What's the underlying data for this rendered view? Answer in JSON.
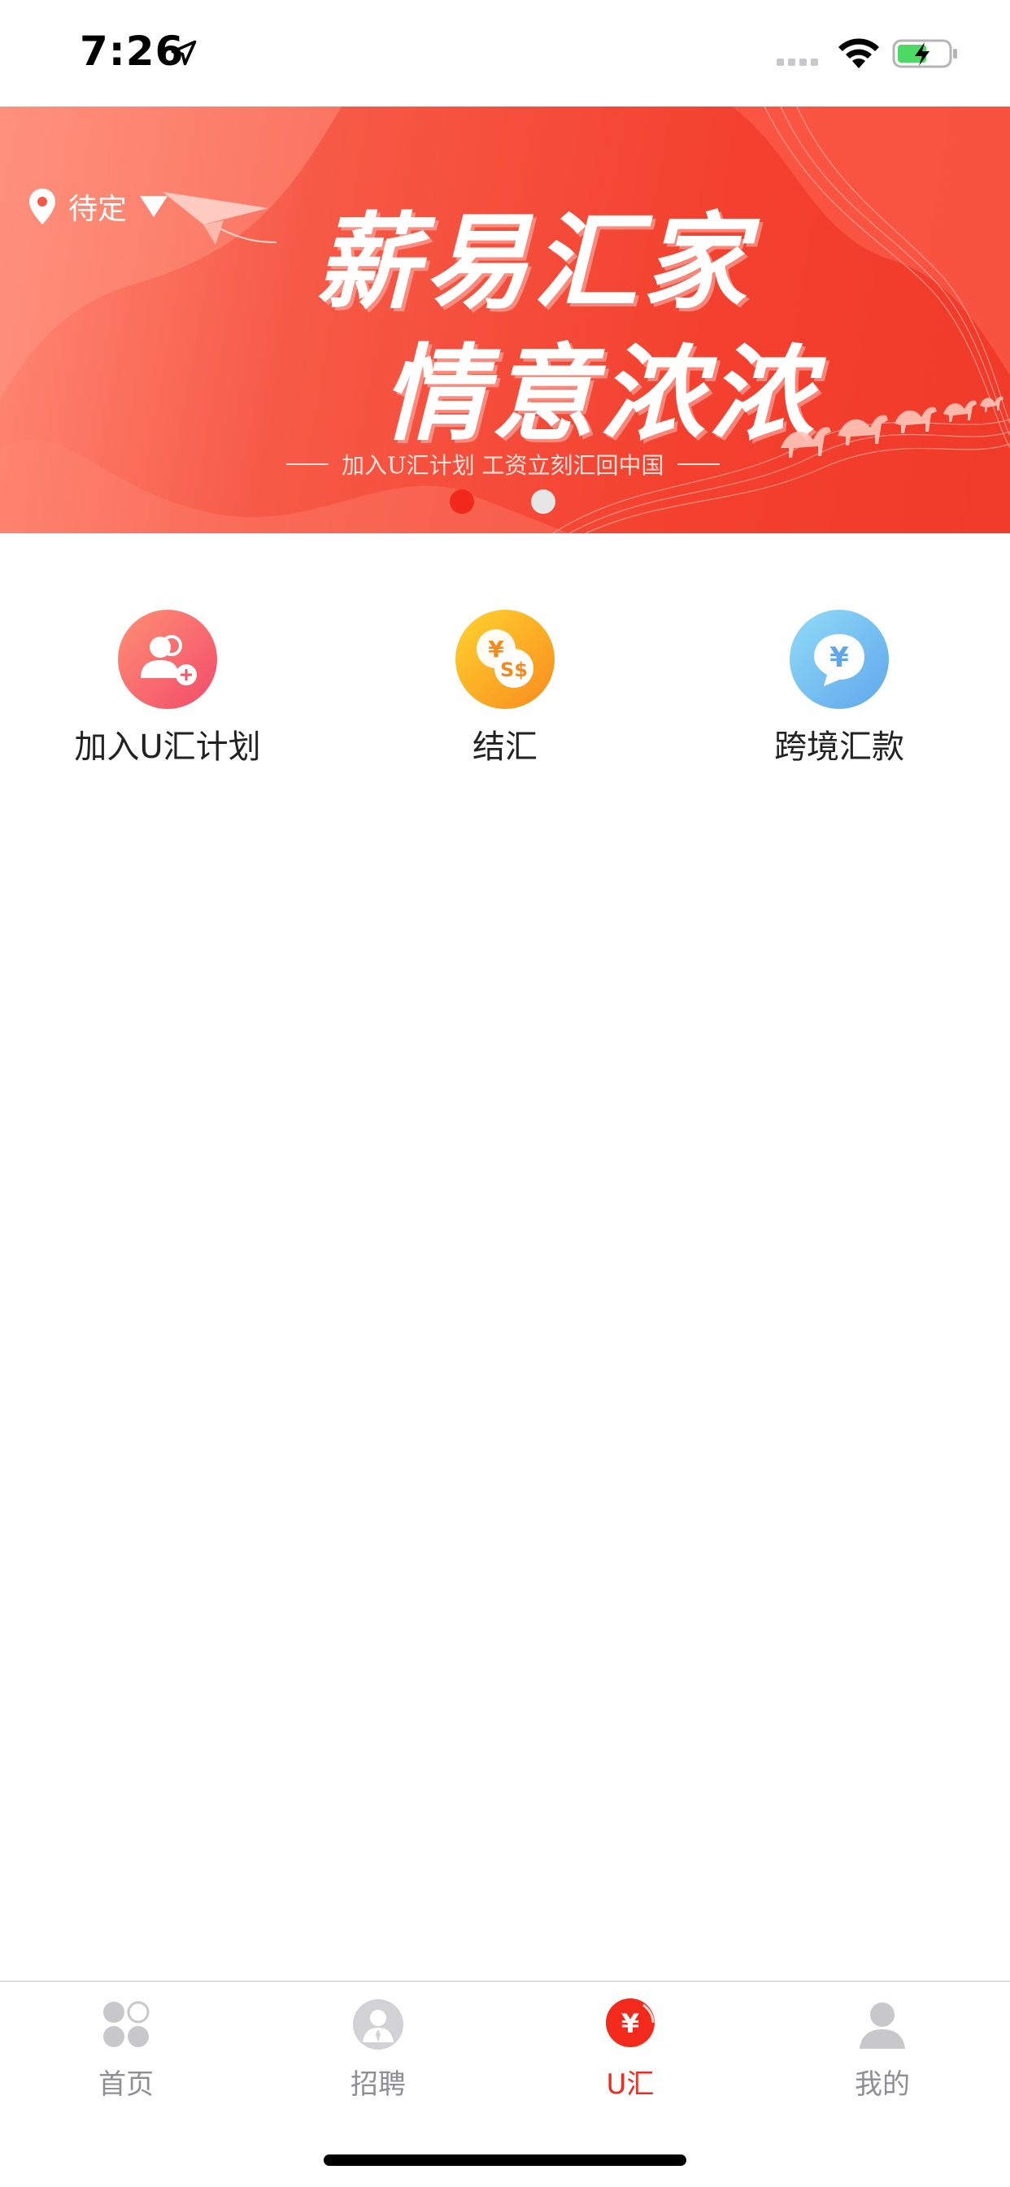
{
  "status_bar": {
    "time": "7:26",
    "icons": [
      "location-arrow-icon",
      "signal-icon",
      "wifi-icon",
      "battery-charging-icon"
    ]
  },
  "banner": {
    "location": "待定",
    "title_line1": "薪易汇家",
    "title_line2": "情意浓浓",
    "tagline": "加入U汇计划  工资立刻汇回中国",
    "pages": 2,
    "active_page": 1,
    "accent_color": "#f03a2a"
  },
  "actions": [
    {
      "label": "加入U汇计划",
      "icon": "add-user-icon",
      "color": "#f4566a"
    },
    {
      "label": "结汇",
      "icon": "currency-exchange-icon",
      "color": "#f8a51f"
    },
    {
      "label": "跨境汇款",
      "icon": "yuan-chat-icon",
      "color": "#6fb5ef"
    }
  ],
  "tabbar": {
    "tabs": [
      {
        "label": "首页",
        "icon": "home-grid-icon",
        "active": false
      },
      {
        "label": "招聘",
        "icon": "recruit-person-icon",
        "active": false
      },
      {
        "label": "U汇",
        "icon": "yuan-icon",
        "active": true
      },
      {
        "label": "我的",
        "icon": "profile-icon",
        "active": false
      }
    ],
    "active_color": "#f12a1c",
    "inactive_color": "#8e8e93"
  }
}
